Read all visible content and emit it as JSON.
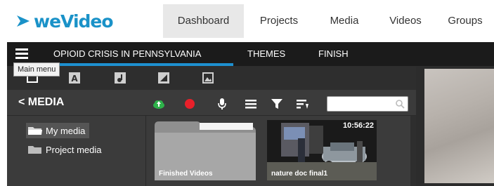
{
  "brand": {
    "logo_text": "weVideo",
    "accent": "#1a92c8"
  },
  "nav": {
    "items": [
      {
        "label": "Dashboard",
        "active": true
      },
      {
        "label": "Projects",
        "active": false
      },
      {
        "label": "Media",
        "active": false
      },
      {
        "label": "Videos",
        "active": false
      },
      {
        "label": "Groups",
        "active": false
      }
    ]
  },
  "project_bar": {
    "menu_icon": "hamburger-icon",
    "tabs": [
      {
        "label": "OPIOID CRISIS IN PENNSYLVANIA",
        "active": true
      },
      {
        "label": "THEMES",
        "active": false
      },
      {
        "label": "FINISH",
        "active": false
      }
    ],
    "tooltip": "Main menu"
  },
  "media_panel": {
    "tab_icons": [
      "video-clip-icon",
      "text-icon",
      "audio-icon",
      "transition-icon",
      "image-icon"
    ],
    "title": "< MEDIA",
    "toolbar_icons": [
      "upload-cloud-icon",
      "record-icon",
      "microphone-icon",
      "list-view-icon",
      "filter-icon",
      "sort-icon"
    ],
    "search": {
      "value": "",
      "placeholder": ""
    },
    "tree": [
      {
        "label": "My media",
        "selected": true
      },
      {
        "label": "Project media",
        "selected": false
      }
    ],
    "tiles": [
      {
        "type": "folder",
        "label": "Finished Videos"
      },
      {
        "type": "video",
        "label": "nature doc final1",
        "duration": "10:56:22"
      }
    ]
  }
}
